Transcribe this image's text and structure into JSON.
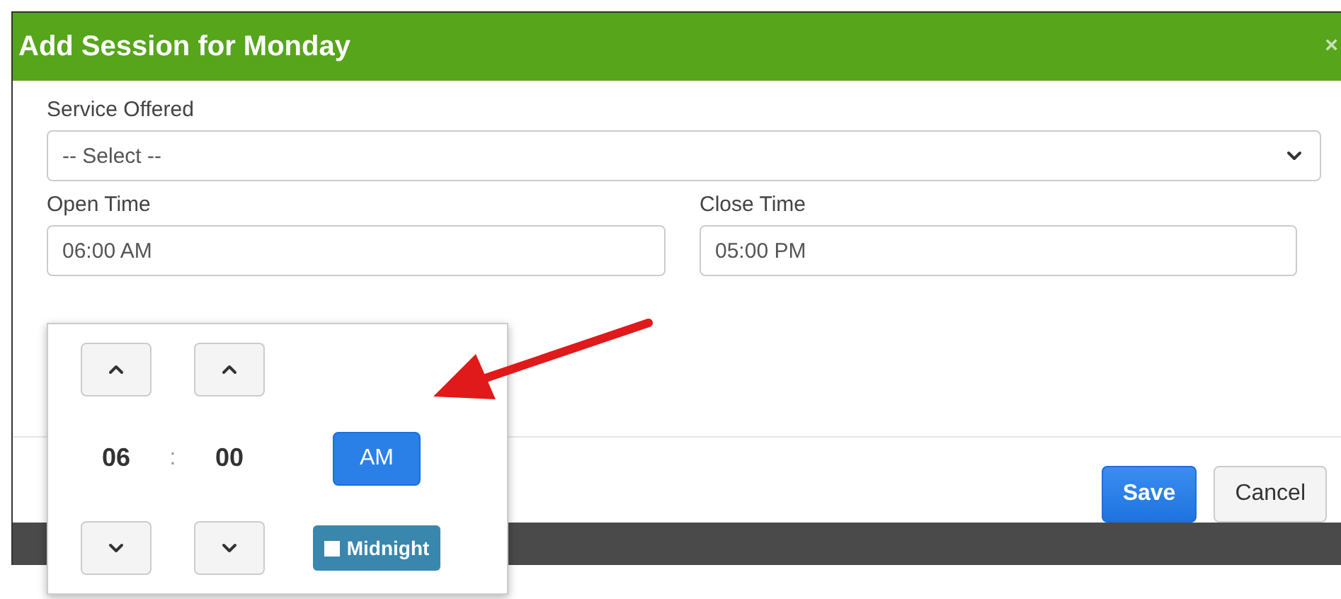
{
  "dialog": {
    "title": "Add Session for Monday",
    "close": "×"
  },
  "service": {
    "label": "Service Offered",
    "value": "-- Select --"
  },
  "open_time": {
    "label": "Open Time",
    "value": "06:00 AM"
  },
  "close_time": {
    "label": "Close Time",
    "value": "05:00 PM"
  },
  "time_picker": {
    "hour": "06",
    "separator": ":",
    "minute": "00",
    "period": "AM",
    "midnight": {
      "label": "Midnight",
      "checked": false
    }
  },
  "buttons": [
    {
      "label": "Save",
      "kind": "primary"
    },
    {
      "label": "Cancel",
      "kind": "default"
    }
  ]
}
